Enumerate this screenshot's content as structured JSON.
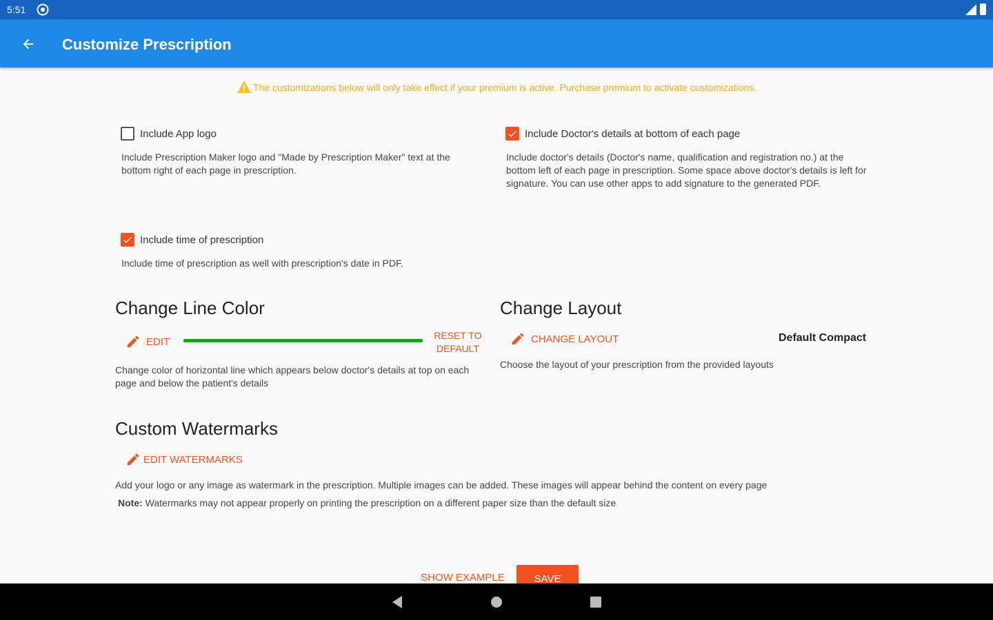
{
  "status_bar": {
    "time": "5:51"
  },
  "app_bar": {
    "title": "Customize Prescription"
  },
  "warning": {
    "text": "The customizations below will only take effect if your premium is active. Purchase premium to activate customizations."
  },
  "options": [
    {
      "label": "Include App logo",
      "checked": false,
      "description": "Include Prescription Maker logo and \"Made by Prescription Maker\" text at the bottom right of each page in prescription."
    },
    {
      "label": "Include Doctor's details at bottom of each page",
      "checked": true,
      "description": "Include doctor's details (Doctor's name, qualification and registration no.) at the bottom left of each page in prescription. Some space above doctor's details is left for signature. You can use other apps to add signature to the generated PDF."
    },
    {
      "label": "Include time of prescription",
      "checked": true,
      "description": "Include time of prescription as well with prescription's date in PDF."
    }
  ],
  "line_color": {
    "title": "Change Line Color",
    "edit_label": "Edit",
    "reset_label": "Reset to default",
    "line_color": "#0eaa12",
    "description": "Change color of horizontal line which appears below doctor's details at top on each page and below the patient's details"
  },
  "layout": {
    "title": "Change Layout",
    "change_label": "Change layout",
    "current_value": "Default Compact",
    "description": "Choose the layout of your prescription from the provided layouts"
  },
  "watermarks": {
    "title": "Custom Watermarks",
    "edit_label": "Edit watermarks",
    "description": "Add your logo or any image as watermark in the prescription. Multiple images can be added. These images will appear behind the content on every page",
    "note_label": "Note:",
    "note_text": " Watermarks may not appear properly on printing the prescription on a different paper size than the default size"
  },
  "actions": {
    "show_example": "Show example",
    "save": "Save"
  },
  "colors": {
    "primary": "#1e88e5",
    "primary_dark": "#1565c0",
    "accent": "#f4511e",
    "warning": "#f9a825"
  },
  "icons": [
    "back-arrow-icon",
    "pencil-icon",
    "warning-icon",
    "check-icon",
    "nav-back-icon",
    "nav-home-icon",
    "nav-recents-icon"
  ]
}
